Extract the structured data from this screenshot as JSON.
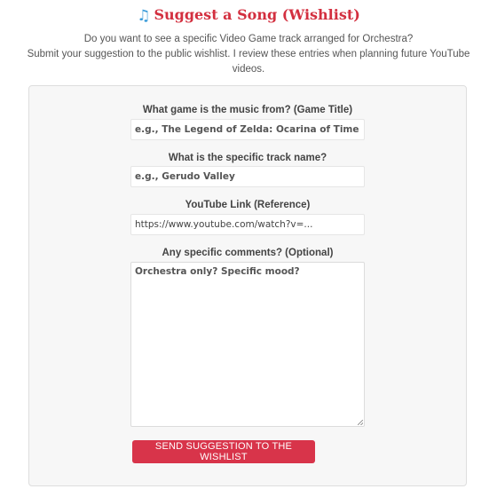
{
  "header": {
    "title_icon": "music-note-icon",
    "title": "Suggest a Song (Wishlist)",
    "title_color": "#d32f3f",
    "icon_color": "#3b9bd9"
  },
  "intro": {
    "line1": "Do you want to see a specific Video Game track arranged for Orchestra?",
    "line2": "Submit your suggestion to the public wishlist. I review these entries when planning future YouTube videos."
  },
  "form": {
    "game_title": {
      "label": "What game is the music from? (Game Title)",
      "placeholder": "e.g., The Legend of Zelda: Ocarina of Time",
      "value": ""
    },
    "track_name": {
      "label": "What is the specific track name?",
      "placeholder": "e.g., Gerudo Valley",
      "value": ""
    },
    "youtube_link": {
      "label": "YouTube Link (Reference)",
      "placeholder": "",
      "value": "https://www.youtube.com/watch?v=..."
    },
    "comments": {
      "label": "Any specific comments? (Optional)",
      "placeholder": "Orchestra only? Specific mood?",
      "value": ""
    },
    "submit_label": "SEND SUGGESTION TO THE WISHLIST",
    "submit_color": "#d8344a"
  }
}
